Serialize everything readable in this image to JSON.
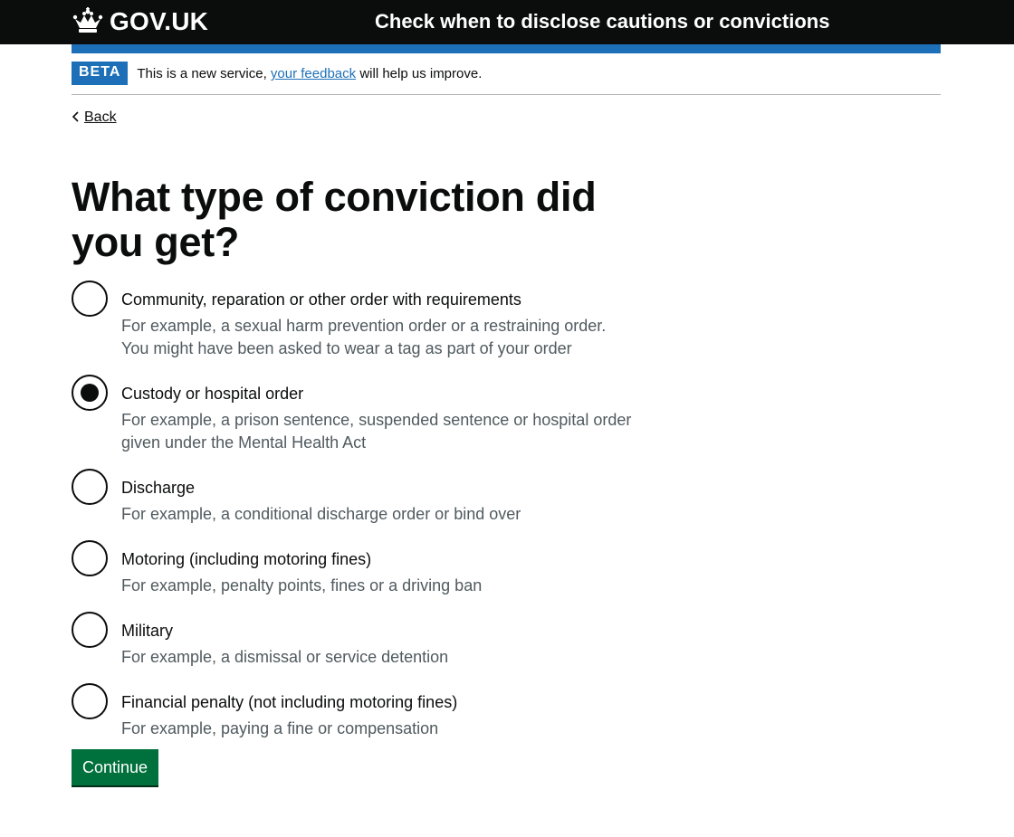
{
  "header": {
    "logo_text": "GOV.UK",
    "logo_icon": "crown-icon",
    "service_name": "Check when to disclose cautions or convictions"
  },
  "phase_banner": {
    "tag": "BETA",
    "text_before": "This is a new service, ",
    "link_text": "your feedback",
    "text_after": " will help us improve."
  },
  "back_link": {
    "label": "Back",
    "icon": "chevron-left-icon"
  },
  "question": {
    "heading": "What type of conviction did you get?",
    "options": [
      {
        "label": "Community, reparation or other order with requirements",
        "hint": "For example, a sexual harm prevention order or a restraining order. You might have been asked to wear a tag as part of your order",
        "selected": false
      },
      {
        "label": "Custody or hospital order",
        "hint": "For example, a prison sentence, suspended sentence or hospital order given under the Mental Health Act",
        "selected": true
      },
      {
        "label": "Discharge",
        "hint": "For example, a conditional discharge order or bind over",
        "selected": false
      },
      {
        "label": "Motoring (including motoring fines)",
        "hint": "For example, penalty points, fines or a driving ban",
        "selected": false
      },
      {
        "label": "Military",
        "hint": "For example, a dismissal or service detention",
        "selected": false
      },
      {
        "label": "Financial penalty (not including motoring fines)",
        "hint": "For example, paying a fine or compensation",
        "selected": false
      }
    ]
  },
  "actions": {
    "continue_label": "Continue"
  },
  "colors": {
    "header_bg": "#0b0c0c",
    "brand_blue": "#1d70b8",
    "button_green": "#00703c",
    "hint_grey": "#505a5f"
  }
}
